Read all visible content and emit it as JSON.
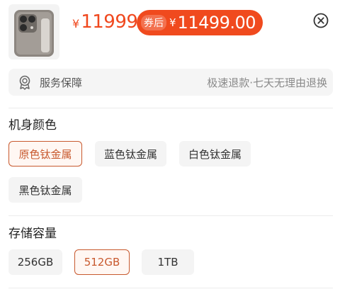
{
  "product": {
    "price_symbol": "¥",
    "price": "11999",
    "coupon_tag": "券后",
    "coupon_symbol": "¥",
    "coupon_price": "11499.00",
    "thumbnail_icon": "phone-thumbnail"
  },
  "close_icon": "close-circle-icon",
  "service": {
    "icon": "badge-icon",
    "label": "服务保障",
    "description": "极速退款·七天无理由退换"
  },
  "color_section": {
    "title": "机身颜色",
    "options": [
      {
        "label": "原色钛金属",
        "selected": true
      },
      {
        "label": "蓝色钛金属",
        "selected": false
      },
      {
        "label": "白色钛金属",
        "selected": false
      },
      {
        "label": "黑色钛金属",
        "selected": false
      }
    ]
  },
  "storage_section": {
    "title": "存储容量",
    "options": [
      {
        "label": "256GB",
        "selected": false
      },
      {
        "label": "512GB",
        "selected": true
      },
      {
        "label": "1TB",
        "selected": false
      }
    ]
  },
  "colors": {
    "accent": "#f0481e",
    "selected_border": "#c8592e"
  }
}
